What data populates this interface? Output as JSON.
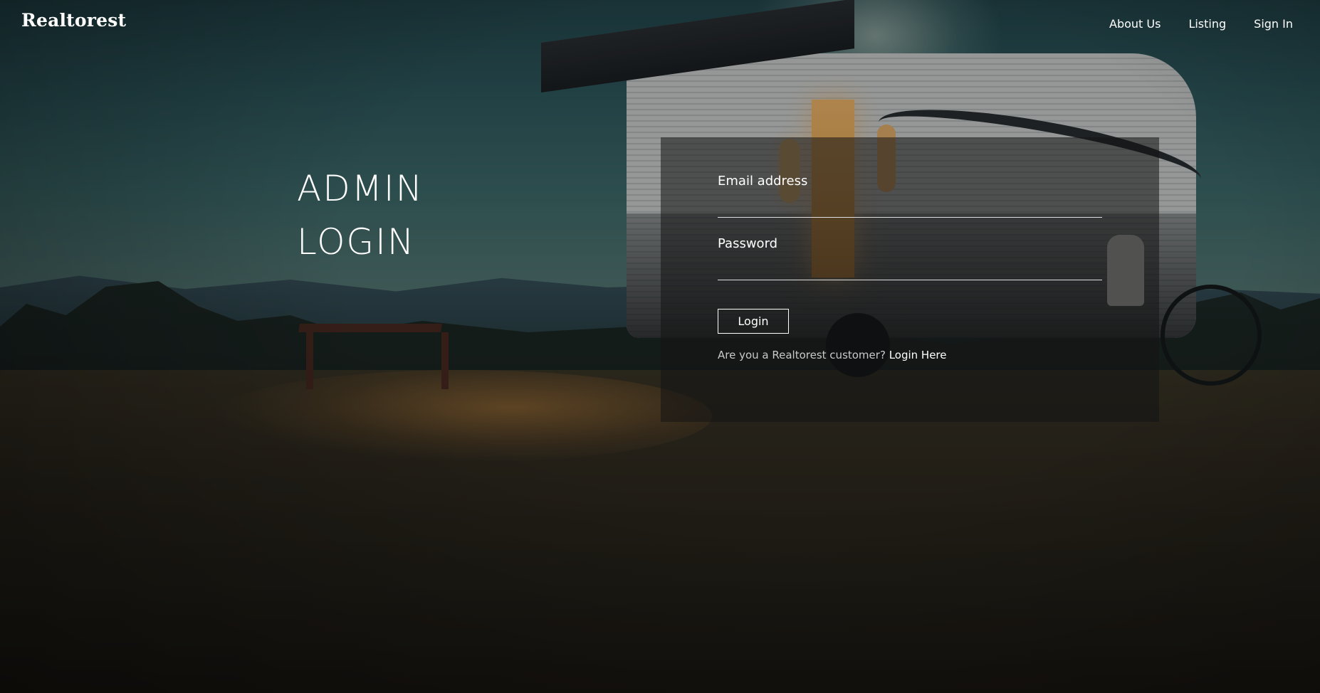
{
  "brand": {
    "name": "Realtorest"
  },
  "nav": {
    "items": [
      {
        "label": "About Us"
      },
      {
        "label": "Listing"
      },
      {
        "label": "Sign In"
      }
    ]
  },
  "hero": {
    "heading_line1": "ADMIN",
    "heading_line2": "LOGIN"
  },
  "login_form": {
    "email_label": "Email address",
    "email_value": "",
    "password_label": "Password",
    "password_value": "",
    "submit_label": "Login",
    "customer_prompt": "Are you a Realtorest customer?",
    "customer_link": "Login Here"
  },
  "colors": {
    "text": "#ffffff",
    "muted_text": "#c9c9c9",
    "panel_background": "rgba(20,20,20,0.55)"
  }
}
